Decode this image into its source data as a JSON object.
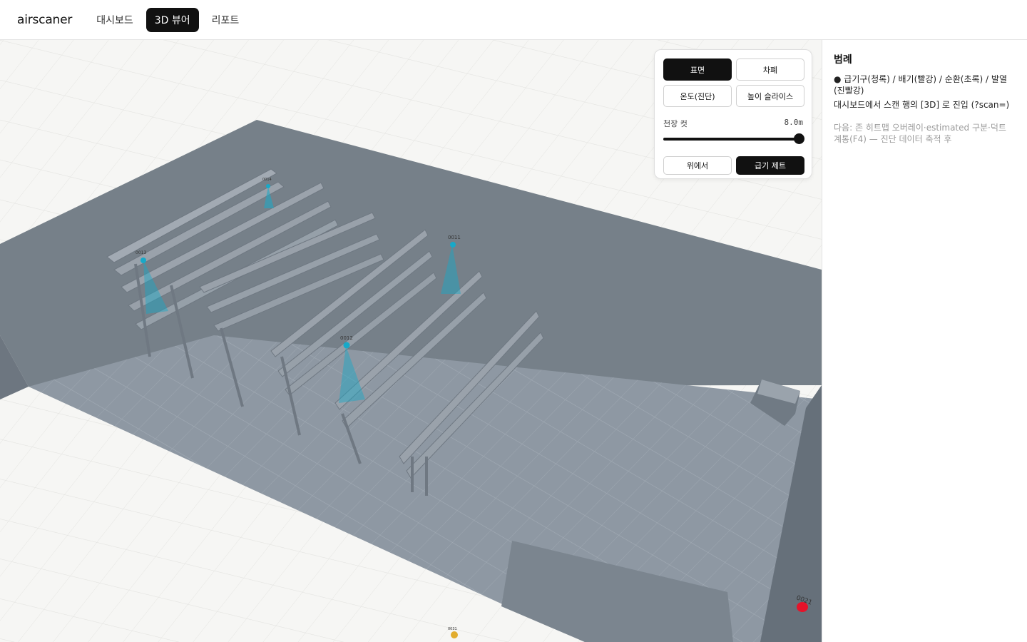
{
  "app": {
    "brand": "airscaner"
  },
  "nav": {
    "tabs": [
      {
        "label": "대시보드",
        "active": false
      },
      {
        "label": "3D 뷰어",
        "active": true
      },
      {
        "label": "리포트",
        "active": false
      }
    ]
  },
  "controls": {
    "view_buttons": [
      {
        "label": "표면",
        "active": true
      },
      {
        "label": "차폐",
        "active": false
      },
      {
        "label": "온도(진단)",
        "active": false
      },
      {
        "label": "높이 슬라이스",
        "active": false
      }
    ],
    "ceiling_cut": {
      "label": "천장 컷",
      "value_text": "8.0m",
      "level": 1.0
    },
    "bottom_buttons": [
      {
        "label": "위에서",
        "active": false
      },
      {
        "label": "급기 제트",
        "active": true
      }
    ]
  },
  "legend": {
    "title": "범례",
    "lines": [
      "● 급기구(청록) / 배기(빨강) / 순환(초록) / 발열(진빨강)",
      "대시보드에서 스캔 행의 [3D] 로 진입 (?scan=)"
    ],
    "note": "다음: 존 히트맵 오버레이·estimated 구분·덕트 계통(F4) — 진단 데이터 축적 후"
  },
  "scene": {
    "markers": [
      {
        "label": "0011",
        "kind": "supply"
      },
      {
        "label": "0012",
        "kind": "supply"
      },
      {
        "label": "0013",
        "kind": "supply"
      },
      {
        "label": "0014",
        "kind": "supply"
      },
      {
        "label": "0021",
        "kind": "exhaust"
      },
      {
        "label": "0031",
        "kind": "circulation"
      }
    ],
    "colors": {
      "supply": "#17a9c8",
      "exhaust": "#e5132a",
      "circulation": "#e2ad2e",
      "floor": "#8e98a3",
      "wall": "#768089"
    }
  }
}
